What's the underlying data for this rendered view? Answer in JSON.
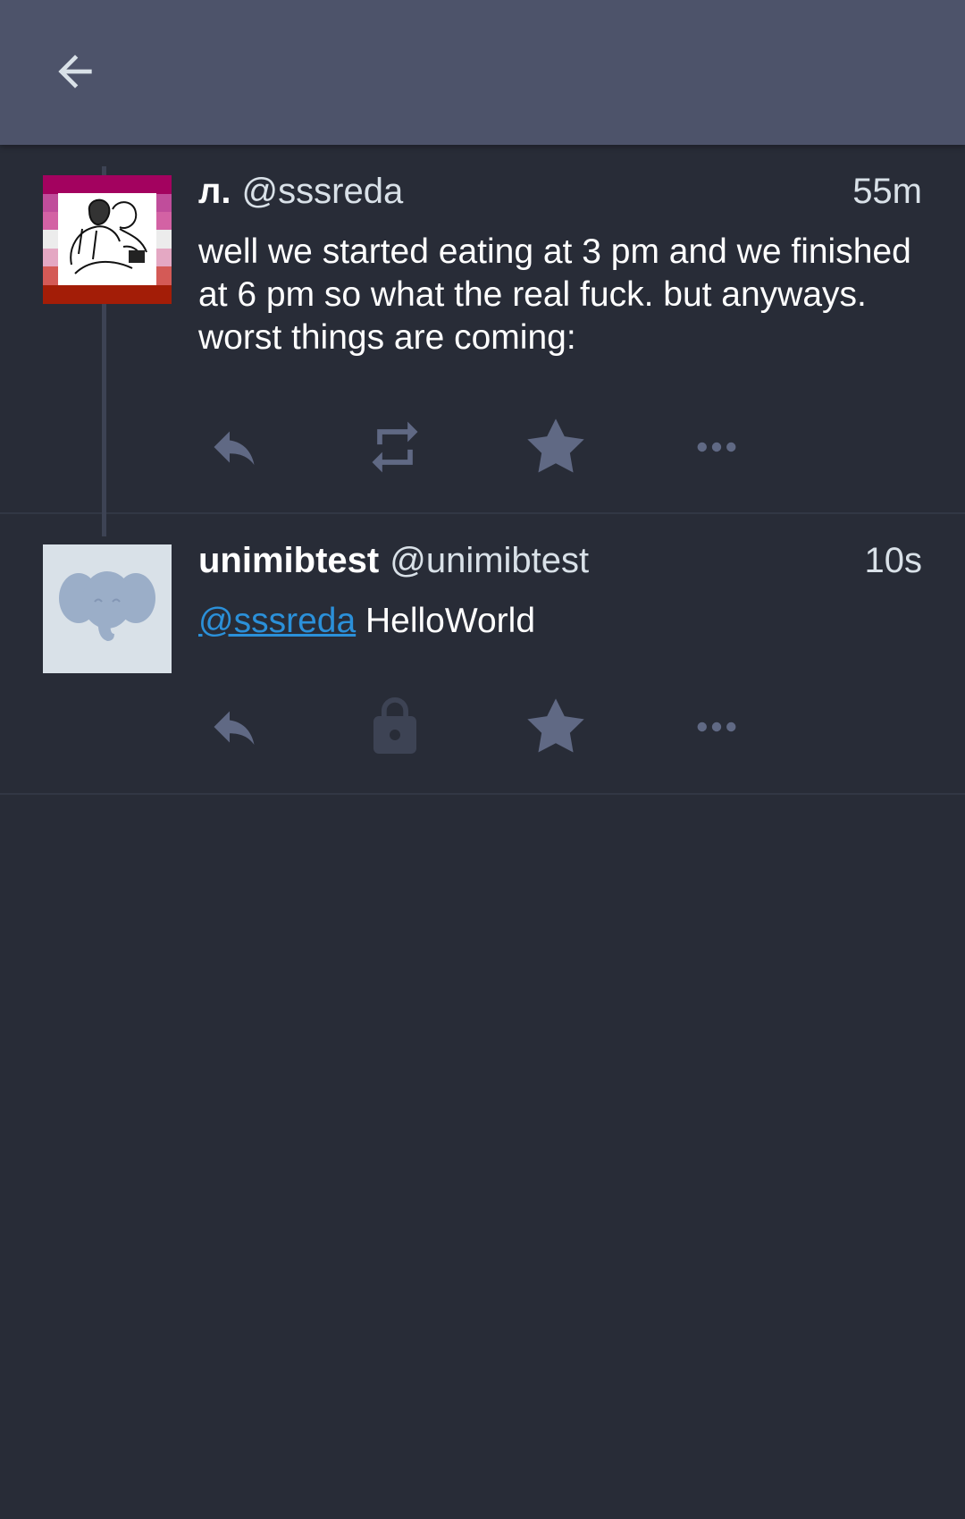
{
  "app_bar": {
    "back_icon": "arrow-left-icon"
  },
  "colors": {
    "background": "#282c37",
    "app_bar": "#4d536a",
    "action_icon": "#606984",
    "lock_icon": "#3d4354",
    "mention": "#2b90d9",
    "text_primary": "#ffffff",
    "text_secondary": "#d9e1e8"
  },
  "statuses": [
    {
      "display_name": "л.",
      "acct": "@sssreda",
      "time": "55m",
      "content": "well we started eating at 3 pm and we finished at 6 pm so what the real fuck. but anyways. worst things are coming:",
      "avatar": "lesbian-flag-drawing-avatar",
      "actions": [
        "reply-icon",
        "boost-icon",
        "favourite-icon",
        "more-icon"
      ]
    },
    {
      "display_name": "unimibtest",
      "acct": "@unimibtest",
      "time": "10s",
      "mention": "@sssreda",
      "content_text": " HelloWorld",
      "avatar": "default-elephant-avatar",
      "actions": [
        "reply-icon",
        "lock-icon",
        "favourite-icon",
        "more-icon"
      ]
    }
  ]
}
